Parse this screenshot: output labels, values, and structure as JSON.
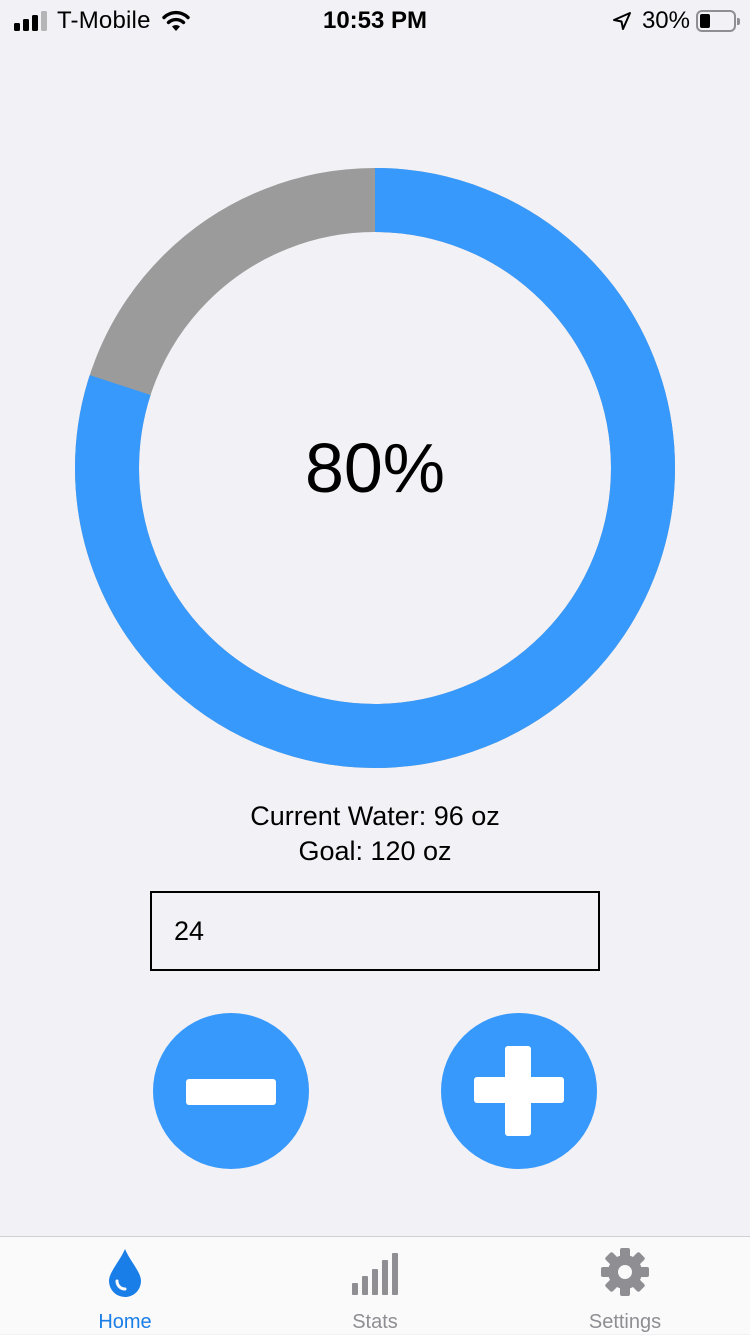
{
  "status_bar": {
    "carrier": "T-Mobile",
    "time": "10:53 PM",
    "battery_percent": "30%",
    "battery_level": 0.3,
    "signal_bars_active": 3,
    "signal_bars_total": 4
  },
  "progress": {
    "percent_label": "80%",
    "fraction": 0.8,
    "fill_color": "#3799fb",
    "track_color": "#9b9b9b"
  },
  "info": {
    "current_water": "Current Water: 96 oz",
    "goal": "Goal: 120 oz"
  },
  "amount_input": {
    "value": "24"
  },
  "buttons": {
    "decrease_icon": "minus-icon",
    "increase_icon": "plus-icon",
    "color": "#3799fb"
  },
  "tab_bar": {
    "active_color": "#1a7ee8",
    "inactive_color": "#8e8e93",
    "tabs": [
      {
        "label": "Home",
        "icon": "water-drop-icon",
        "active": true
      },
      {
        "label": "Stats",
        "icon": "bar-chart-icon",
        "active": false
      },
      {
        "label": "Settings",
        "icon": "gear-icon",
        "active": false
      }
    ]
  }
}
